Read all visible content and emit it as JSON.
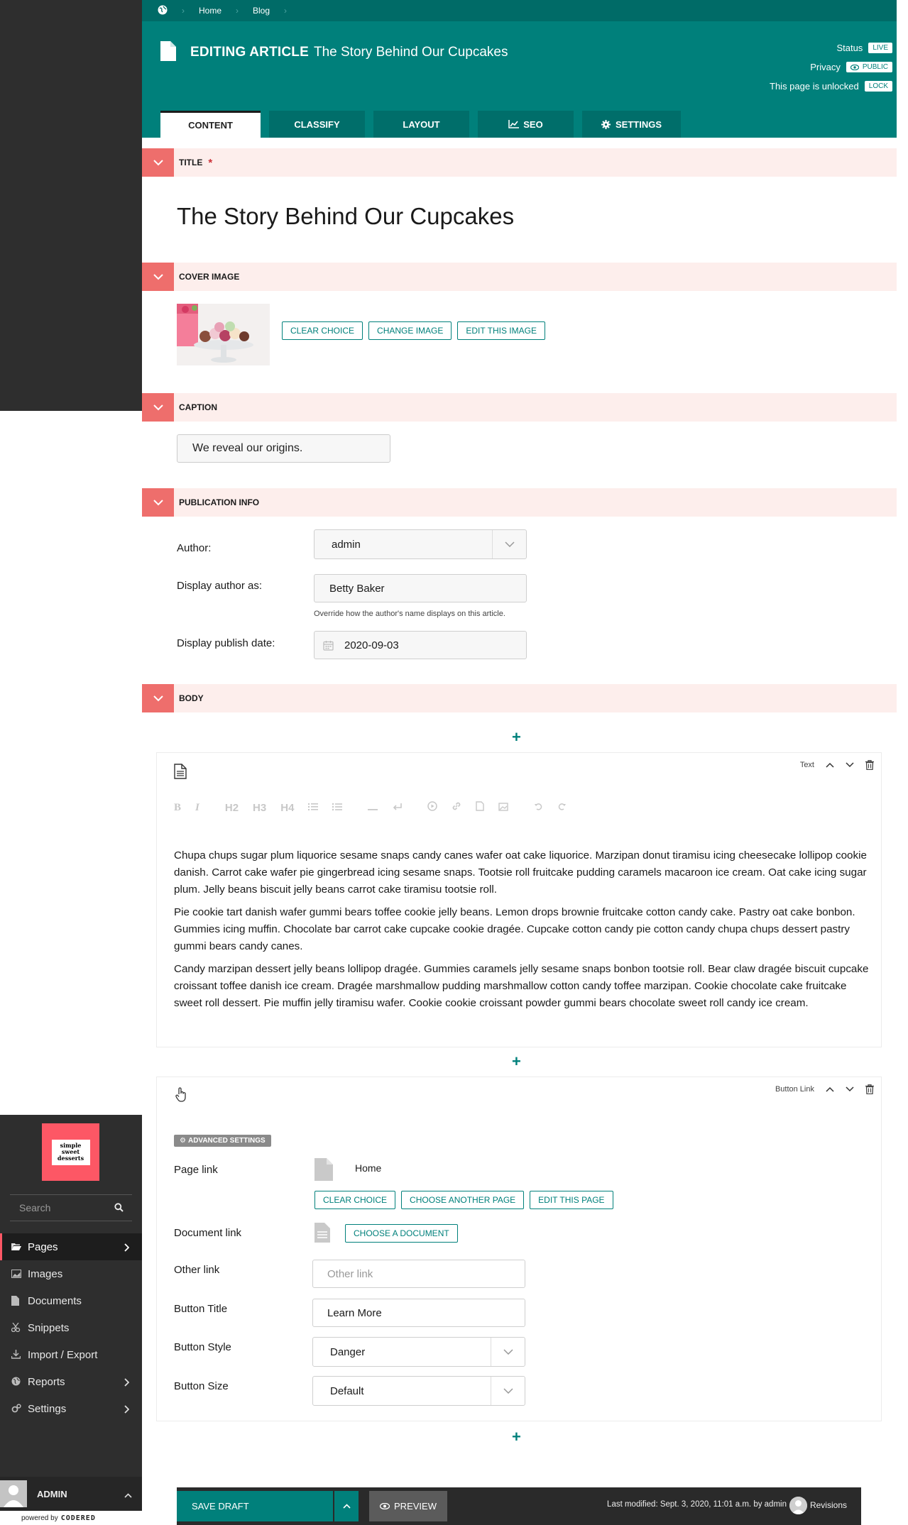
{
  "breadcrumbs": [
    "Home",
    "Blog"
  ],
  "header": {
    "editing_label": "EDITING ARTICLE",
    "page_title": "The Story Behind Our Cupcakes",
    "status_label": "Status",
    "status_value": "LIVE",
    "privacy_label": "Privacy",
    "privacy_value": "PUBLIC",
    "lock_text": "This page is unlocked",
    "lock_button": "LOCK"
  },
  "tabs": [
    {
      "label": "CONTENT",
      "icon": ""
    },
    {
      "label": "CLASSIFY",
      "icon": ""
    },
    {
      "label": "LAYOUT",
      "icon": ""
    },
    {
      "label": "SEO",
      "icon": "chart-line-icon"
    },
    {
      "label": "SETTINGS",
      "icon": "gear-icon"
    }
  ],
  "sections": {
    "title": {
      "label": "TITLE",
      "required": "*",
      "value": "The Story Behind Our Cupcakes"
    },
    "cover_image": {
      "label": "COVER IMAGE",
      "buttons": [
        "CLEAR CHOICE",
        "CHANGE IMAGE",
        "EDIT THIS IMAGE"
      ]
    },
    "caption": {
      "label": "CAPTION",
      "value": "We reveal our origins."
    },
    "publication": {
      "label": "PUBLICATION INFO",
      "author_label": "Author:",
      "author_value": "admin",
      "display_author_label": "Display author as:",
      "display_author_value": "Betty Baker",
      "display_author_help": "Override how the author's name displays on this article.",
      "publish_date_label": "Display publish date:",
      "publish_date_value": "2020-09-03"
    },
    "body": {
      "label": "BODY"
    }
  },
  "add_symbol": "+",
  "text_block": {
    "type_label": "Text",
    "toolbar": [
      "B",
      "I",
      "H2",
      "H3",
      "H4"
    ],
    "paragraphs": [
      "Chupa chups sugar plum liquorice sesame snaps candy canes wafer oat cake liquorice. Marzipan donut tiramisu icing cheesecake lollipop cookie danish. Carrot cake wafer pie gingerbread icing sesame snaps. Tootsie roll fruitcake pudding caramels macaroon ice cream. Oat cake icing sugar plum. Jelly beans biscuit jelly beans carrot cake tiramisu tootsie roll.",
      "Pie cookie tart danish wafer gummi bears toffee cookie jelly beans. Lemon drops brownie fruitcake cotton candy cake. Pastry oat cake bonbon. Gummies icing muffin. Chocolate bar carrot cake cupcake cookie dragée. Cupcake cotton candy pie cotton candy chupa chups dessert pastry gummi bears candy canes.",
      "Candy marzipan dessert jelly beans lollipop dragée. Gummies caramels jelly sesame snaps bonbon tootsie roll. Bear claw dragée biscuit cupcake croissant toffee danish ice cream. Dragée marshmallow pudding marshmallow cotton candy toffee marzipan. Cookie chocolate cake fruitcake sweet roll dessert. Pie muffin jelly tiramisu wafer. Cookie cookie croissant powder gummi bears chocolate sweet roll candy ice cream."
    ]
  },
  "button_block": {
    "type_label": "Button Link",
    "advanced": "ADVANCED SETTINGS",
    "page_link_label": "Page link",
    "page_link_value": "Home",
    "page_buttons": [
      "CLEAR CHOICE",
      "CHOOSE ANOTHER PAGE",
      "EDIT THIS PAGE"
    ],
    "document_link_label": "Document link",
    "document_button": "CHOOSE A DOCUMENT",
    "other_link_label": "Other link",
    "other_link_placeholder": "Other link",
    "button_title_label": "Button Title",
    "button_title_value": "Learn More",
    "button_style_label": "Button Style",
    "button_style_value": "Danger",
    "button_size_label": "Button Size",
    "button_size_value": "Default"
  },
  "sidebar": {
    "logo_lines": [
      "simple",
      "sweet",
      "desserts"
    ],
    "search_placeholder": "Search",
    "items": [
      {
        "label": "Pages",
        "icon": "folder-open-icon",
        "has_sub": true,
        "active": true
      },
      {
        "label": "Images",
        "icon": "image-icon",
        "has_sub": false
      },
      {
        "label": "Documents",
        "icon": "document-icon",
        "has_sub": false
      },
      {
        "label": "Snippets",
        "icon": "snippet-icon",
        "has_sub": false
      },
      {
        "label": "Import / Export",
        "icon": "download-icon",
        "has_sub": false
      },
      {
        "label": "Reports",
        "icon": "globe-icon",
        "has_sub": true
      },
      {
        "label": "Settings",
        "icon": "cogs-icon",
        "has_sub": true
      }
    ],
    "user_name": "ADMIN",
    "powered_by": "powered by",
    "powered_brand": "CODERED"
  },
  "footer": {
    "save_label": "SAVE DRAFT",
    "preview_label": "PREVIEW",
    "last_modified": "Last modified: Sept. 3, 2020, 11:01 a.m. by admin",
    "revisions_label": "Revisions"
  },
  "colors": {
    "teal": "#00807b",
    "coral": "#ee6e6c",
    "section_bg": "#fdeeec",
    "sidebar": "#2e2e2e",
    "logo": "#fd5765"
  }
}
